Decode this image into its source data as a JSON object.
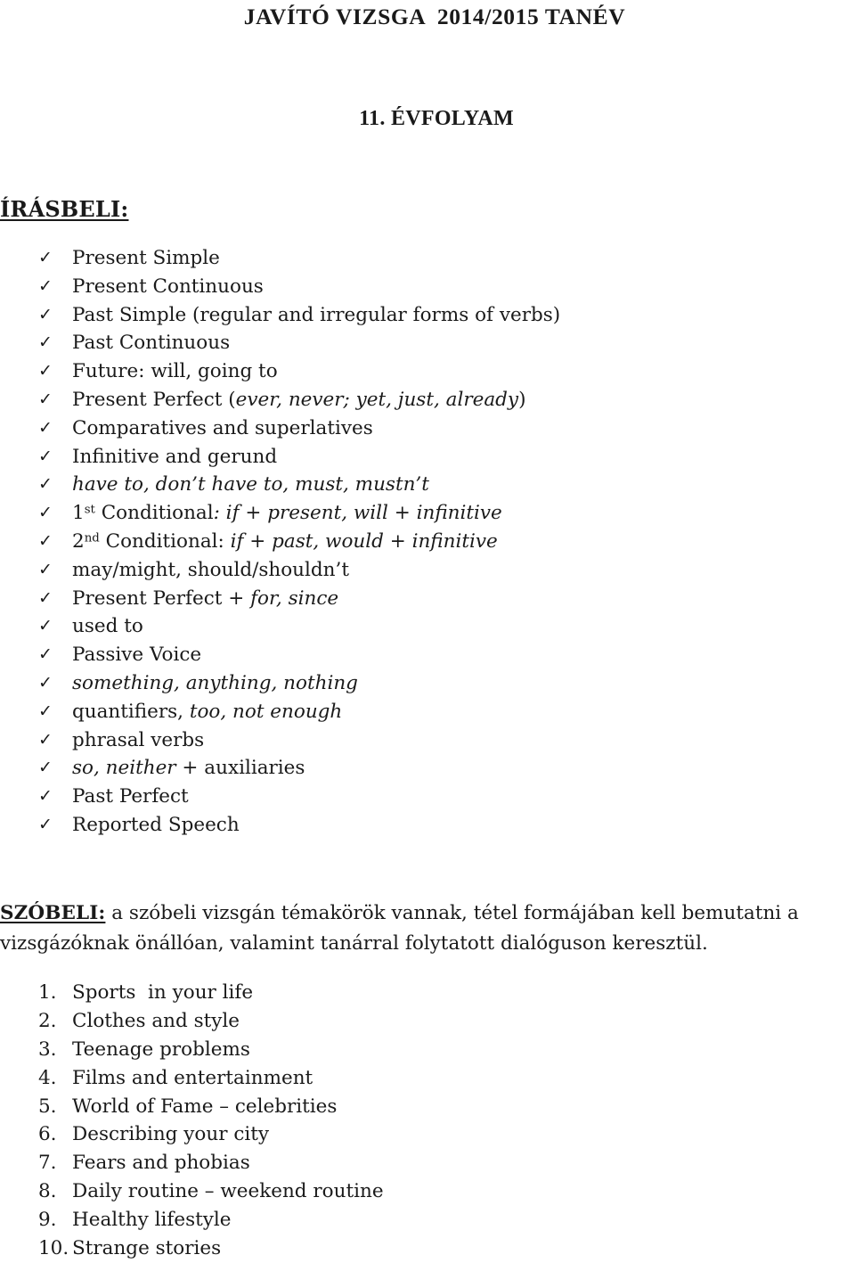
{
  "document": {
    "title": "JAVÍTÓ VIZSGA  2014/2015 TANÉV",
    "grade": "11. ÉVFOLYAM"
  },
  "written": {
    "heading": "ÍRÁSBELI:",
    "bullet_icon": "check-icon",
    "items": [
      {
        "parts": [
          {
            "text": "Present Simple",
            "style": "normal"
          }
        ]
      },
      {
        "parts": [
          {
            "text": "Present Continuous",
            "style": "normal"
          }
        ]
      },
      {
        "parts": [
          {
            "text": "Past Simple (regular and irregular forms of verbs)",
            "style": "normal"
          }
        ]
      },
      {
        "parts": [
          {
            "text": "Past Continuous",
            "style": "normal"
          }
        ]
      },
      {
        "parts": [
          {
            "text": "Future: will, going to",
            "style": "normal"
          }
        ]
      },
      {
        "parts": [
          {
            "text": "Present Perfect (",
            "style": "normal"
          },
          {
            "text": "ever, never; yet, just, already",
            "style": "italic"
          },
          {
            "text": ")",
            "style": "normal"
          }
        ]
      },
      {
        "parts": [
          {
            "text": "Comparatives and superlatives",
            "style": "normal"
          }
        ]
      },
      {
        "parts": [
          {
            "text": "Infinitive and gerund",
            "style": "normal"
          }
        ]
      },
      {
        "parts": [
          {
            "text": "have to, don’t have to, must, mustn’t",
            "style": "italic"
          }
        ]
      },
      {
        "parts": [
          {
            "text": "1",
            "style": "normal"
          },
          {
            "text": "st",
            "style": "superscript"
          },
          {
            "text": " Conditional",
            "style": "normal"
          },
          {
            "text": ": if + present, will + infinitive",
            "style": "italic"
          }
        ]
      },
      {
        "parts": [
          {
            "text": "2",
            "style": "normal"
          },
          {
            "text": "nd",
            "style": "superscript"
          },
          {
            "text": " Conditional: ",
            "style": "normal"
          },
          {
            "text": "if + past, would + infinitive",
            "style": "italic"
          }
        ]
      },
      {
        "parts": [
          {
            "text": "may/might, should/shouldn’t",
            "style": "normal"
          }
        ]
      },
      {
        "parts": [
          {
            "text": "Present Perfect + ",
            "style": "normal"
          },
          {
            "text": "for, since",
            "style": "italic"
          }
        ]
      },
      {
        "parts": [
          {
            "text": "used to",
            "style": "normal"
          }
        ]
      },
      {
        "parts": [
          {
            "text": "Passive Voice",
            "style": "normal"
          }
        ]
      },
      {
        "parts": [
          {
            "text": "something, anything, nothing",
            "style": "italic"
          }
        ]
      },
      {
        "parts": [
          {
            "text": "quantifiers, ",
            "style": "normal"
          },
          {
            "text": "too, not enough",
            "style": "italic"
          }
        ]
      },
      {
        "parts": [
          {
            "text": "phrasal verbs",
            "style": "normal"
          }
        ]
      },
      {
        "parts": [
          {
            "text": "so, neither",
            "style": "italic"
          },
          {
            "text": " + auxiliaries",
            "style": "normal"
          }
        ]
      },
      {
        "parts": [
          {
            "text": "Past Perfect",
            "style": "normal"
          }
        ]
      },
      {
        "parts": [
          {
            "text": "Reported Speech",
            "style": "normal"
          }
        ]
      }
    ]
  },
  "oral": {
    "label": "SZÓBELI:",
    "description": " a szóbeli vizsgán témakörök vannak, tétel formájában kell bemutatni a vizsgázóknak önállóan, valamint tanárral folytatott dialóguson keresztül.",
    "topics": [
      {
        "number": "1.",
        "label": "Sports  in your life"
      },
      {
        "number": "2.",
        "label": "Clothes and style"
      },
      {
        "number": "3.",
        "label": "Teenage problems"
      },
      {
        "number": "4.",
        "label": "Films and entertainment"
      },
      {
        "number": "5.",
        "label": "World of Fame – celebrities"
      },
      {
        "number": "6.",
        "label": "Describing your city"
      },
      {
        "number": "7.",
        "label": "Fears and phobias"
      },
      {
        "number": "8.",
        "label": "Daily routine – weekend routine"
      },
      {
        "number": "9.",
        "label": "Healthy lifestyle"
      },
      {
        "number": "10.",
        "label": "Strange stories"
      }
    ]
  },
  "icons": {
    "check": "✓"
  },
  "colors": {
    "text": "#1a1a1a",
    "background": "#ffffff"
  }
}
